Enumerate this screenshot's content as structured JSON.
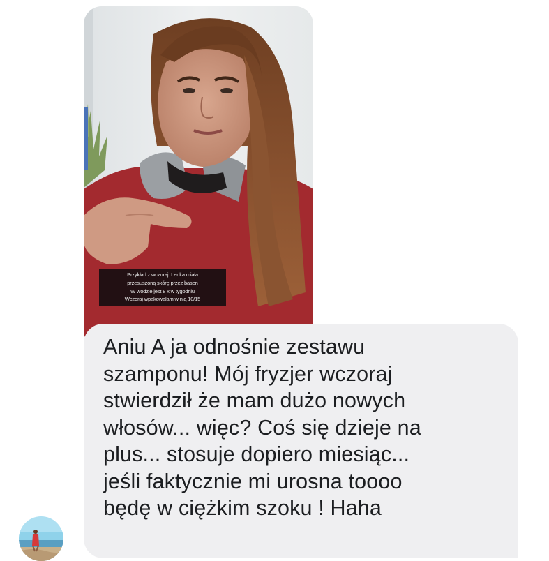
{
  "story": {
    "caption_lines": [
      "Przykład z wczoraj. Lenka miała",
      "przesuszoną skórę przez basen",
      "W wodzie jest 8 x w tygodniu",
      "Wczoraj wpakowałam w nią 10/15"
    ]
  },
  "message": {
    "lines": [
      "Aniu A ja odnośnie zestawu",
      "szamponu! Mój fryzjer wczoraj",
      "stwierdził że mam dużo nowych",
      "włosów... więc? Coś się dzieje na",
      "plus... stosuje dopiero miesiąc...",
      "jeśli faktycznie mi urosna toooo",
      "będę w ciężkim szoku ! Haha"
    ]
  },
  "colors": {
    "bubble_bg": "#efeff1",
    "text": "#1c1e21"
  }
}
